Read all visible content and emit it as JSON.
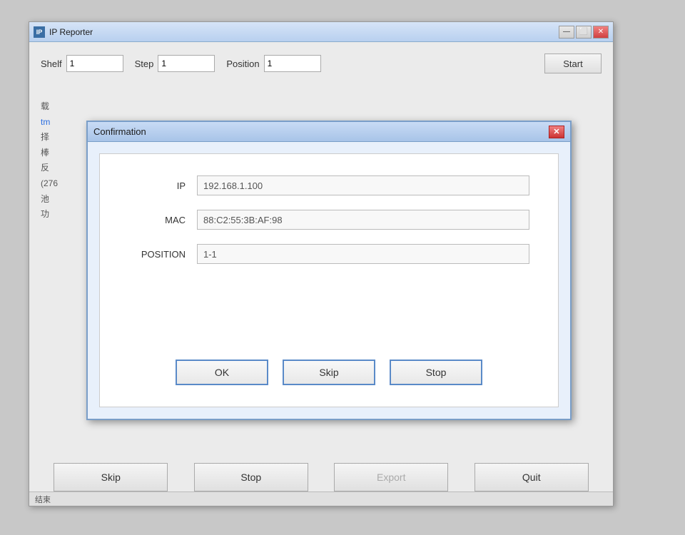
{
  "window": {
    "title": "IP Reporter",
    "icon_label": "IP"
  },
  "title_controls": {
    "minimize": "—",
    "maximize": "⬜",
    "close": "✕"
  },
  "toolbar": {
    "shelf_label": "Shelf",
    "shelf_value": "1",
    "step_label": "Step",
    "step_value": "1",
    "position_label": "Position",
    "position_value": "1",
    "start_label": "Start"
  },
  "left_panel": {
    "lines": [
      "载",
      "tm",
      "择",
      "棒",
      "反",
      "(276",
      "池",
      "功"
    ]
  },
  "bottom_buttons": {
    "skip_label": "Skip",
    "stop_label": "Stop",
    "export_label": "Export",
    "quit_label": "Quit"
  },
  "status_bar": {
    "text": "结束"
  },
  "dialog": {
    "title": "Confirmation",
    "close_icon": "✕",
    "ip_label": "IP",
    "ip_value": "192.168.1.100",
    "mac_label": "MAC",
    "mac_value": "88:C2:55:3B:AF:98",
    "position_label": "POSITION",
    "position_value": "1-1",
    "ok_label": "OK",
    "skip_label": "Skip",
    "stop_label": "Stop"
  }
}
